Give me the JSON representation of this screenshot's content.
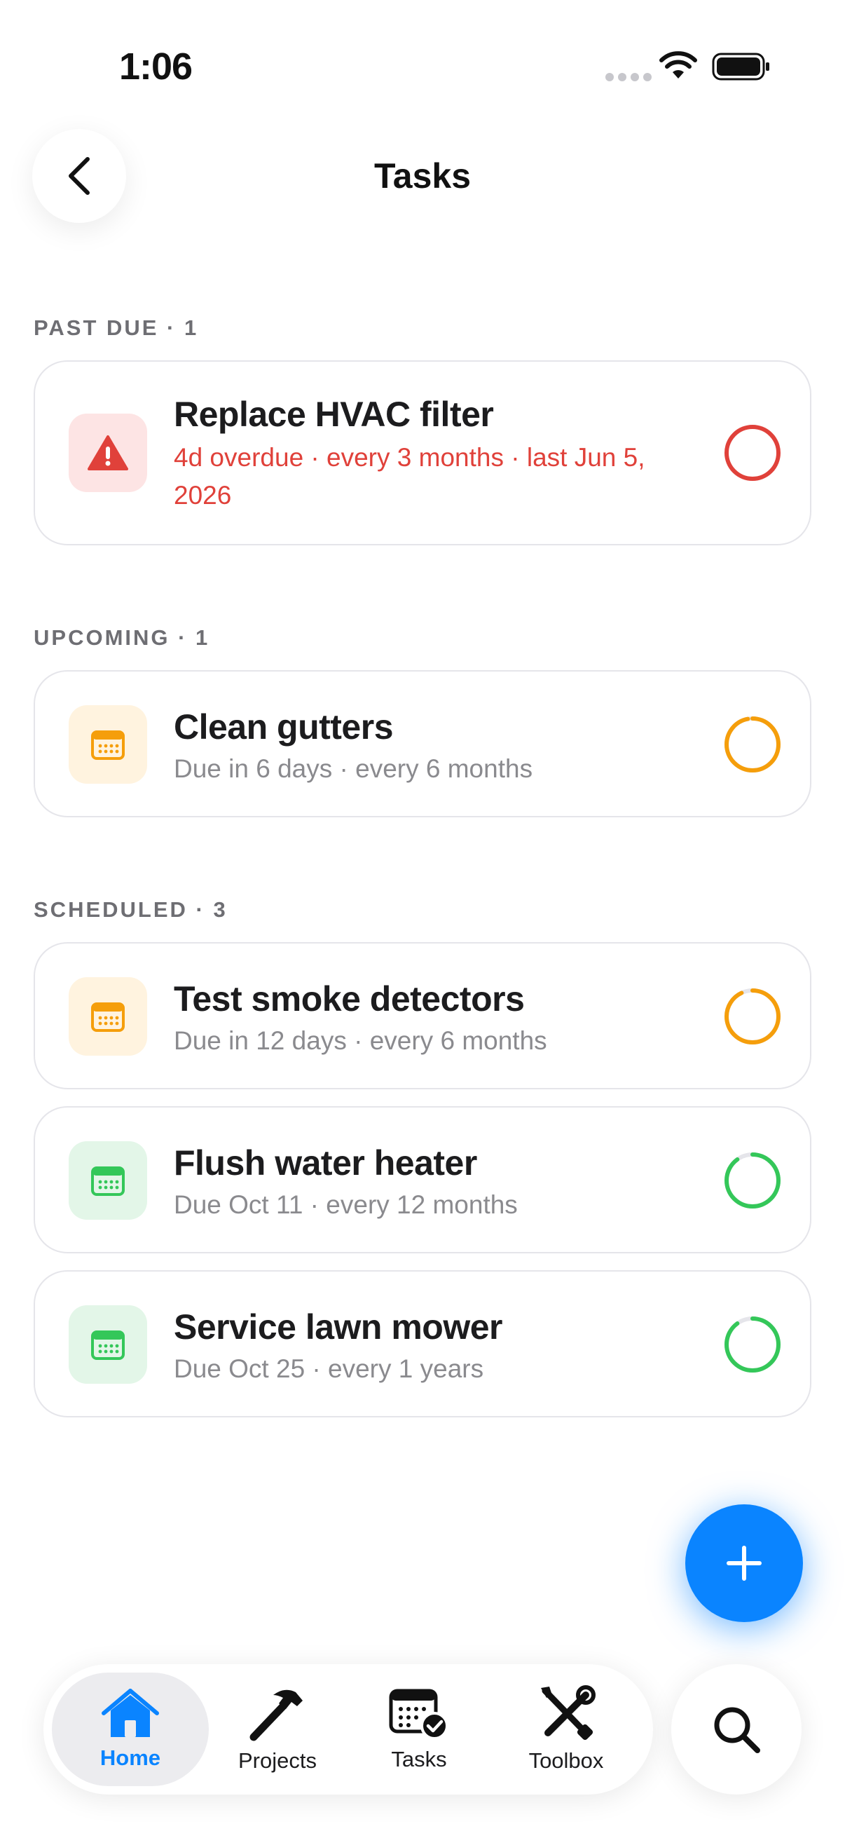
{
  "status_bar": {
    "time": "1:06"
  },
  "header": {
    "title": "Tasks"
  },
  "sections": [
    {
      "label": "PAST DUE · 1",
      "tasks": [
        {
          "title": "Replace HVAC filter",
          "subtitle": "4d overdue · every 3 months · last Jun 5, 2026",
          "status": "overdue",
          "icon": "warning-icon",
          "ring_progress": 1.0
        }
      ]
    },
    {
      "label": "UPCOMING · 1",
      "tasks": [
        {
          "title": "Clean gutters",
          "subtitle": "Due in 6 days · every 6 months",
          "status": "upcoming",
          "icon": "calendar-icon",
          "ring_progress": 0.97
        }
      ]
    },
    {
      "label": "SCHEDULED · 3",
      "tasks": [
        {
          "title": "Test smoke detectors",
          "subtitle": "Due in 12 days · every 6 months",
          "status": "scheduled-soon",
          "icon": "calendar-icon",
          "ring_progress": 0.93
        },
        {
          "title": "Flush water heater",
          "subtitle": "Due Oct 11 · every 12 months",
          "status": "scheduled",
          "icon": "calendar-icon",
          "ring_progress": 0.9
        },
        {
          "title": "Service lawn mower",
          "subtitle": "Due Oct 25 · every 1 years",
          "status": "scheduled",
          "icon": "calendar-icon",
          "ring_progress": 0.9
        }
      ]
    }
  ],
  "tab_bar": {
    "items": [
      {
        "label": "Home",
        "icon": "house-icon",
        "active": true
      },
      {
        "label": "Projects",
        "icon": "hammer-icon",
        "active": false
      },
      {
        "label": "Tasks",
        "icon": "calendar-check-icon",
        "active": false
      },
      {
        "label": "Toolbox",
        "icon": "wrench-screwdriver-icon",
        "active": false
      }
    ]
  },
  "colors": {
    "accent": "#0a84ff",
    "overdue": "#e0413a",
    "overdue_bg": "#fde4e4",
    "upcoming": "#f59e0b",
    "upcoming_bg": "#fff3df",
    "scheduled": "#34c759",
    "scheduled_bg": "#e3f6e8",
    "ring_track": "#e5e5ea"
  }
}
